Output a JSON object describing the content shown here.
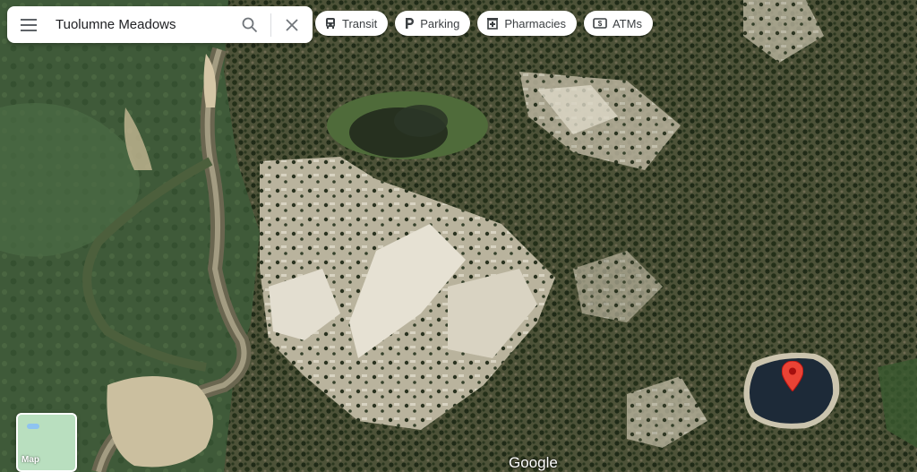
{
  "search": {
    "value": "Tuolumne Meadows"
  },
  "icons": {
    "menu": "menu-icon",
    "search": "search-icon",
    "clear": "close-icon",
    "pin": "location-pin-icon"
  },
  "chips": [
    {
      "label": "Transit",
      "icon": "transit-icon"
    },
    {
      "label": "Parking",
      "icon": "parking-icon"
    },
    {
      "label": "Pharmacies",
      "icon": "pharmacy-icon"
    },
    {
      "label": "ATMs",
      "icon": "atm-icon"
    }
  ],
  "layer_toggle": {
    "label": "Map"
  },
  "brand": {
    "logo_text": "Google"
  },
  "colors": {
    "pin": "#ea4335",
    "chip_bg": "#ffffff",
    "lake": "#1d2a38"
  }
}
